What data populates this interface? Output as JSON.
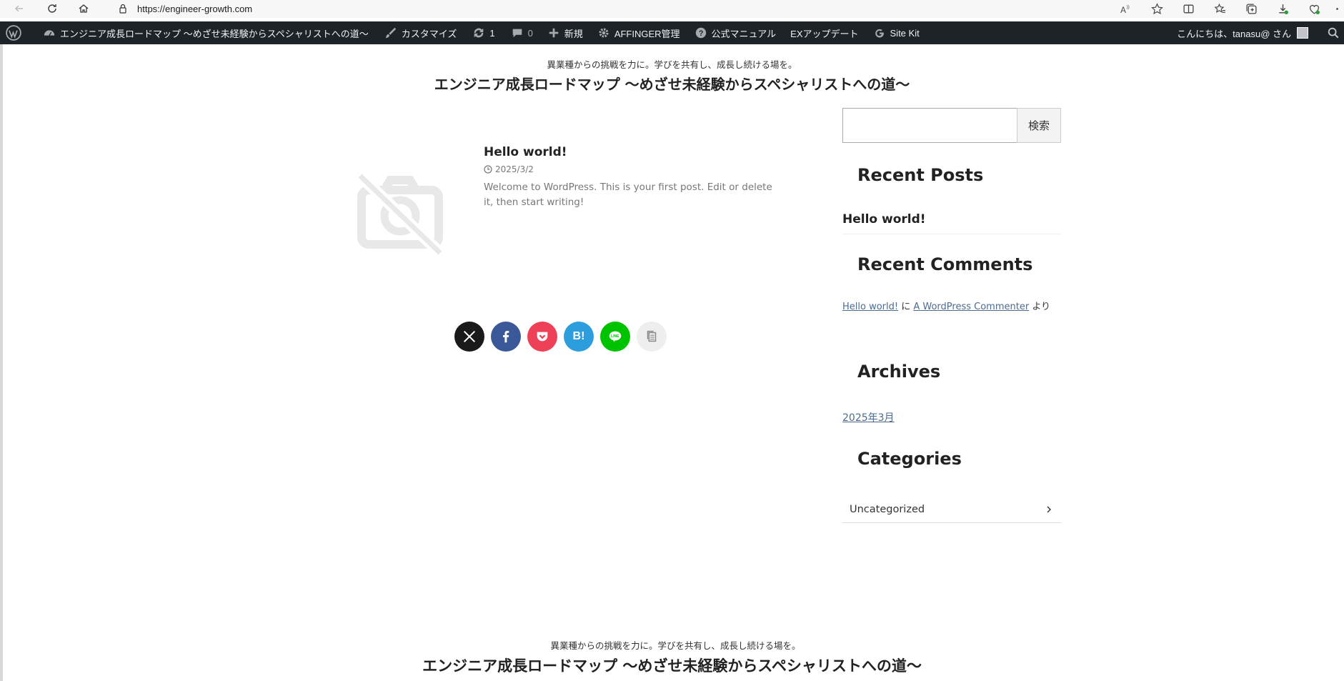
{
  "browser": {
    "url": "https://engineer-growth.com",
    "nav_icons": [
      "back-icon",
      "refresh-icon",
      "home-icon"
    ],
    "action_icons": [
      "read-aloud-icon",
      "favorite-star-icon",
      "split-screen-icon",
      "favorites-icon",
      "collections-icon",
      "downloads-icon",
      "browser-essentials-icon"
    ]
  },
  "admin_bar": {
    "site_name": "エンジニア成長ロードマップ 〜めざせ未経験からスペシャリストへの道〜",
    "customize": "カスタマイズ",
    "updates_count": "1",
    "comments_count": "0",
    "new": "新規",
    "affinger": "AFFINGER管理",
    "manual": "公式マニュアル",
    "ex_update": "EXアップデート",
    "site_kit": "Site Kit",
    "greeting": "こんにちは、tanasu@ さん"
  },
  "header": {
    "description": "異業種からの挑戦を力に。学びを共有し、成長し続ける場を。",
    "title": "エンジニア成長ロードマップ 〜めざせ未経験からスペシャリストへの道〜"
  },
  "post": {
    "title": "Hello world!",
    "date": "2025/3/2",
    "excerpt": "Welcome to WordPress. This is your first post. Edit or delete it, then start writing!"
  },
  "share": {
    "hatena_label": "B!",
    "colors": {
      "x": "#1a1a1a",
      "facebook": "#3b5998",
      "pocket": "#ee4056",
      "hatena": "#2c9edd",
      "line": "#00c300",
      "copy": "#eeeeee"
    }
  },
  "sidebar": {
    "search_button": "検索",
    "recent_posts_title": "Recent Posts",
    "recent_posts": [
      "Hello world!"
    ],
    "recent_comments_title": "Recent Comments",
    "comment": {
      "post_link": "Hello world!",
      "connector": " に ",
      "author_link": "A WordPress Commenter",
      "suffix": " より"
    },
    "archives_title": "Archives",
    "archive_link": "2025年3月",
    "categories_title": "Categories",
    "category": "Uncategorized"
  },
  "footer": {
    "description": "異業種からの挑戦を力に。学びを共有し、成長し続ける場を。",
    "title": "エンジニア成長ロードマップ 〜めざせ未経験からスペシャリストへの道〜"
  }
}
